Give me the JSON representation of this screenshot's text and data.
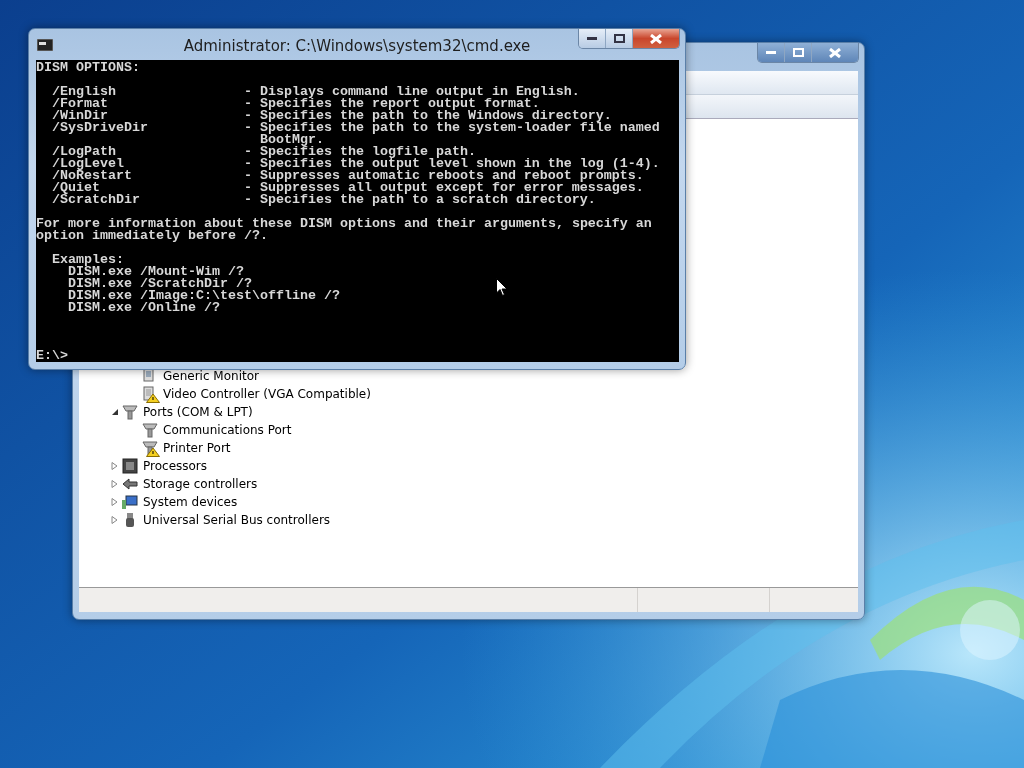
{
  "cmd_window": {
    "title": "Administrator: C:\\Windows\\system32\\cmd.exe",
    "heading": "DISM OPTIONS:",
    "options": [
      {
        "option": "/English",
        "description": "- Displays command line output in English."
      },
      {
        "option": "/Format",
        "description": "- Specifies the report output format."
      },
      {
        "option": "/WinDir",
        "description": "- Specifies the path to the Windows directory."
      },
      {
        "option": "/SysDriveDir",
        "description": "- Specifies the path to the system-loader file named",
        "continuation": "BootMgr."
      },
      {
        "option": "/LogPath",
        "description": "- Specifies the logfile path."
      },
      {
        "option": "/LogLevel",
        "description": "- Specifies the output level shown in the log (1-4)."
      },
      {
        "option": "/NoRestart",
        "description": "- Suppresses automatic reboots and reboot prompts."
      },
      {
        "option": "/Quiet",
        "description": "- Suppresses all output except for error messages."
      },
      {
        "option": "/ScratchDir",
        "description": "- Specifies the path to a scratch directory."
      }
    ],
    "info": [
      "For more information about these DISM options and their arguments, specify an",
      "option immediately before /?."
    ],
    "examples_heading": "Examples:",
    "examples": [
      "DISM.exe /Mount-Wim /?",
      "DISM.exe /ScratchDir /?",
      "DISM.exe /Image:C:\\test\\offline /?",
      "DISM.exe /Online /?"
    ],
    "prompt": "E:\\>"
  },
  "device_manager": {
    "tree": {
      "continued_children": [
        {
          "label": "Generic Monitor",
          "kind": "monitor",
          "warning": false
        },
        {
          "label": "Video Controller (VGA Compatible)",
          "kind": "display",
          "warning": true
        }
      ],
      "items": [
        {
          "label": "Ports (COM & LPT)",
          "kind": "port",
          "expanded": true,
          "children": [
            {
              "label": "Communications Port",
              "kind": "port",
              "warning": false
            },
            {
              "label": "Printer Port",
              "kind": "port",
              "warning": true
            }
          ]
        },
        {
          "label": "Processors",
          "kind": "chip",
          "expanded": false
        },
        {
          "label": "Storage controllers",
          "kind": "storage",
          "expanded": false
        },
        {
          "label": "System devices",
          "kind": "system",
          "expanded": false
        },
        {
          "label": "Universal Serial Bus controllers",
          "kind": "usb",
          "expanded": false
        }
      ]
    }
  }
}
